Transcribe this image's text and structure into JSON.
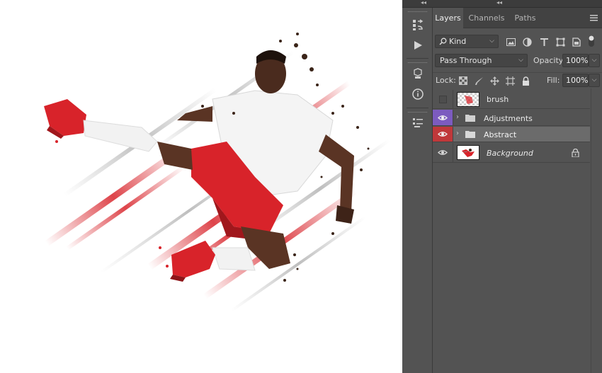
{
  "panel_tabs": [
    {
      "label": "Layers",
      "active": true
    },
    {
      "label": "Channels",
      "active": false
    },
    {
      "label": "Paths",
      "active": false
    }
  ],
  "filter": {
    "kind_label": "Kind",
    "search_icon": "search-icon"
  },
  "blend": {
    "mode": "Pass Through",
    "opacity_label": "Opacity:",
    "opacity_value": "100%"
  },
  "lock": {
    "label": "Lock:",
    "fill_label": "Fill:",
    "fill_value": "100%"
  },
  "layers": [
    {
      "name": "brush",
      "visible": false,
      "type": "pixel",
      "selected": false,
      "italic": false
    },
    {
      "name": "Adjustments",
      "visible": true,
      "type": "group",
      "selected": false,
      "italic": false,
      "eye_color": "#7c5bbf"
    },
    {
      "name": "Abstract",
      "visible": true,
      "type": "group",
      "selected": true,
      "italic": false,
      "eye_color": "#c0383a"
    },
    {
      "name": "Background",
      "visible": true,
      "type": "pixel",
      "selected": false,
      "italic": true,
      "locked": true
    }
  ],
  "colors": {
    "panel_bg": "#535353",
    "tabs_bg": "#424242",
    "selected_row": "#6b6b6b",
    "adjustments_tag": "#7c5bbf",
    "abstract_tag": "#c0383a",
    "artwork_red": "#d8232a"
  }
}
